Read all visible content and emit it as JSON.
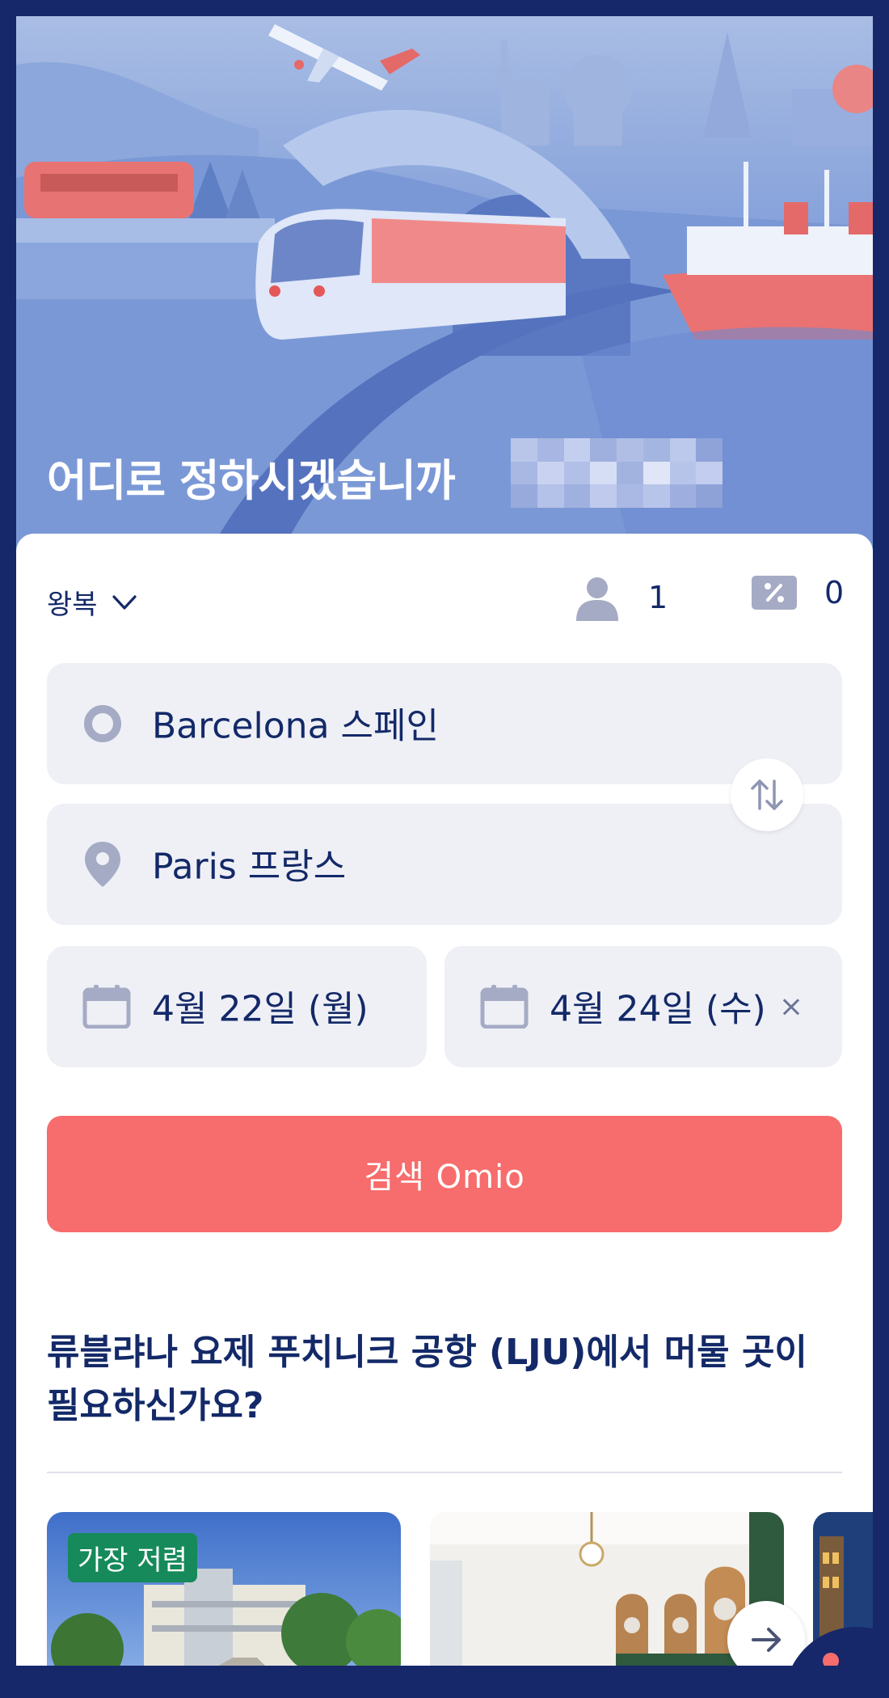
{
  "hero": {
    "title": "어디로 정하시겠습니까"
  },
  "search": {
    "trip_type": "왕복",
    "passengers": "1",
    "discounts": "0",
    "origin": "Barcelona 스페인",
    "destination": "Paris 프랑스",
    "depart_date": "4월 22일 (월)",
    "return_date": "4월 24일 (수)",
    "clear_symbol": "×",
    "submit_label": "검색  Omio"
  },
  "stays": {
    "title": " 류블랴나 요제 푸치니크 공항 (LJU)에서 머물 곳이 필요하신가요?",
    "cheapest_badge": "가장 저렴"
  },
  "colors": {
    "navy": "#16276a",
    "accent": "#f76c6c",
    "field_bg": "#eff0f6",
    "badge_green": "#168a5a"
  },
  "icons": [
    "chevron-down-icon",
    "person-icon",
    "discount-icon",
    "origin-circle-icon",
    "location-pin-icon",
    "swap-arrows-icon",
    "calendar-icon",
    "close-icon",
    "arrow-right-icon",
    "chat-icon"
  ]
}
